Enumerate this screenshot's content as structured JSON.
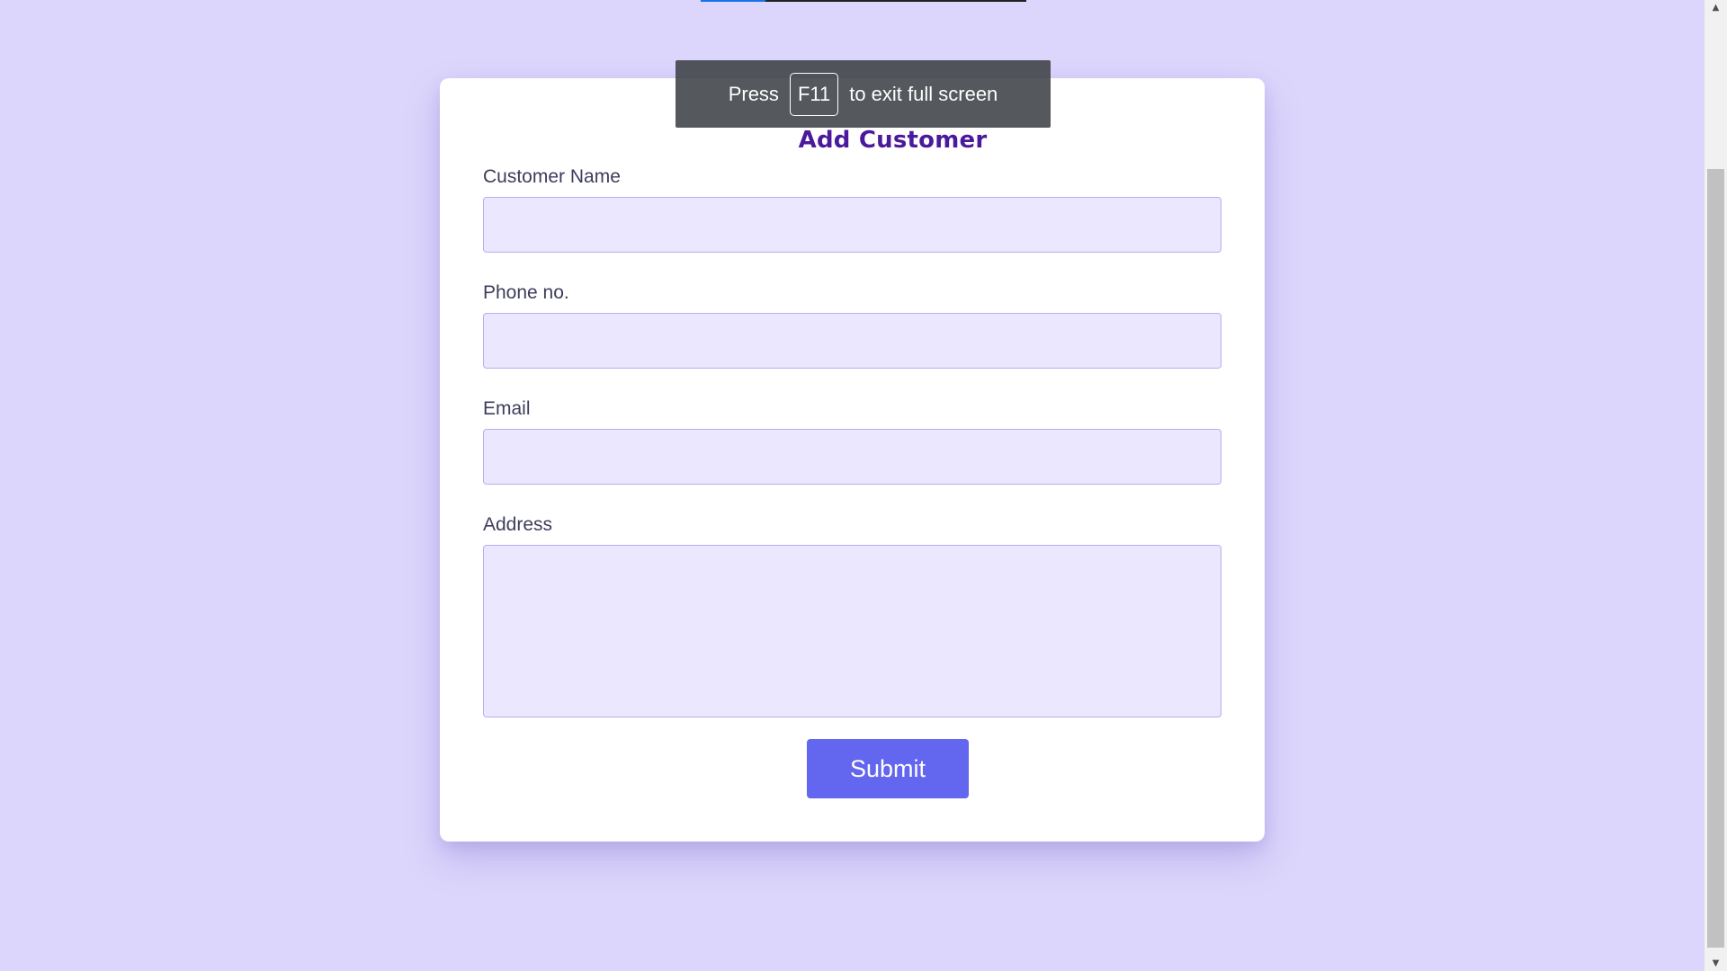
{
  "form": {
    "title": "Add Customer",
    "fields": [
      {
        "label": "Customer Name",
        "value": "",
        "placeholder": ""
      },
      {
        "label": "Phone no.",
        "value": "",
        "placeholder": ""
      },
      {
        "label": "Email",
        "value": "",
        "placeholder": ""
      },
      {
        "label": "Address",
        "value": "",
        "placeholder": ""
      }
    ],
    "submit_label": "Submit"
  },
  "fullscreen_notice": {
    "prefix": "Press",
    "key": "F11",
    "suffix": "to exit full screen"
  },
  "colors": {
    "page_background": "#dcd6fc",
    "title": "#4b1a9c",
    "input_background": "#ebe7fe",
    "button": "#6366ee"
  },
  "scrollbar": {
    "up_icon": "triangle-up-icon",
    "down_icon": "triangle-down-icon"
  }
}
